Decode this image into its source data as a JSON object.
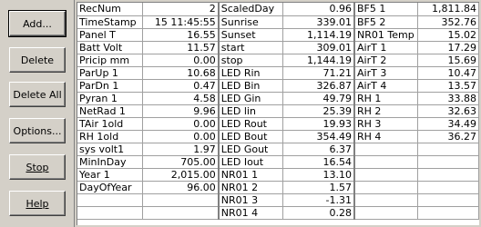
{
  "buttons": [
    {
      "label": "Add...",
      "key": "add"
    },
    {
      "label": "Delete",
      "key": "delete"
    },
    {
      "label": "Delete All",
      "key": "delete-all"
    },
    {
      "label": "Options...",
      "key": "options"
    },
    {
      "label": "Stop",
      "key": "stop"
    },
    {
      "label": "Help",
      "key": "help"
    }
  ],
  "table": {
    "col1": [
      {
        "name": "RecNum",
        "value": "2"
      },
      {
        "name": "TimeStamp",
        "value": "15 11:45:55"
      },
      {
        "name": "Panel T",
        "value": "16.55"
      },
      {
        "name": "Batt Volt",
        "value": "11.57"
      },
      {
        "name": "Pricip mm",
        "value": "0.00"
      },
      {
        "name": "ParUp 1",
        "value": "10.68"
      },
      {
        "name": "ParDn 1",
        "value": "0.47"
      },
      {
        "name": "Pyran 1",
        "value": "4.58"
      },
      {
        "name": "NetRad 1",
        "value": "9.96"
      },
      {
        "name": "TAir 1old",
        "value": "0.00"
      },
      {
        "name": "RH 1old",
        "value": "0.00"
      },
      {
        "name": "sys volt1",
        "value": "1.97"
      },
      {
        "name": "MinInDay",
        "value": "705.00"
      },
      {
        "name": "Year 1",
        "value": "2,015.00"
      },
      {
        "name": "DayOfYear",
        "value": "96.00"
      },
      {
        "name": "",
        "value": ""
      },
      {
        "name": "",
        "value": ""
      }
    ],
    "col2": [
      {
        "name": "ScaledDay",
        "value": "0.96"
      },
      {
        "name": "Sunrise",
        "value": "339.01"
      },
      {
        "name": "Sunset",
        "value": "1,114.19"
      },
      {
        "name": "start",
        "value": "309.01"
      },
      {
        "name": "stop",
        "value": "1,144.19"
      },
      {
        "name": "LED Rin",
        "value": "71.21"
      },
      {
        "name": "LED Bin",
        "value": "326.87"
      },
      {
        "name": "LED Gin",
        "value": "49.79"
      },
      {
        "name": "LED lin",
        "value": "25.39"
      },
      {
        "name": "LED Rout",
        "value": "19.93"
      },
      {
        "name": "LED Bout",
        "value": "354.49"
      },
      {
        "name": "LED Gout",
        "value": "6.37"
      },
      {
        "name": "LED Iout",
        "value": "16.54"
      },
      {
        "name": "NR01 1",
        "value": "13.10"
      },
      {
        "name": "NR01 2",
        "value": "1.57"
      },
      {
        "name": "NR01 3",
        "value": "-1.31"
      },
      {
        "name": "NR01 4",
        "value": "0.28"
      }
    ],
    "col3": [
      {
        "name": "BF5 1",
        "value": "1,811.84"
      },
      {
        "name": "BF5 2",
        "value": "352.76"
      },
      {
        "name": "NR01 Temp",
        "value": "15.02"
      },
      {
        "name": "AirT 1",
        "value": "17.29"
      },
      {
        "name": "AirT 2",
        "value": "15.69"
      },
      {
        "name": "AirT 3",
        "value": "10.47"
      },
      {
        "name": "AirT 4",
        "value": "13.57"
      },
      {
        "name": "RH 1",
        "value": "33.88"
      },
      {
        "name": "RH 2",
        "value": "32.63"
      },
      {
        "name": "RH 3",
        "value": "34.49"
      },
      {
        "name": "RH 4",
        "value": "36.27"
      },
      {
        "name": "",
        "value": ""
      },
      {
        "name": "",
        "value": ""
      },
      {
        "name": "",
        "value": ""
      },
      {
        "name": "",
        "value": ""
      },
      {
        "name": "",
        "value": ""
      },
      {
        "name": "",
        "value": ""
      }
    ]
  }
}
